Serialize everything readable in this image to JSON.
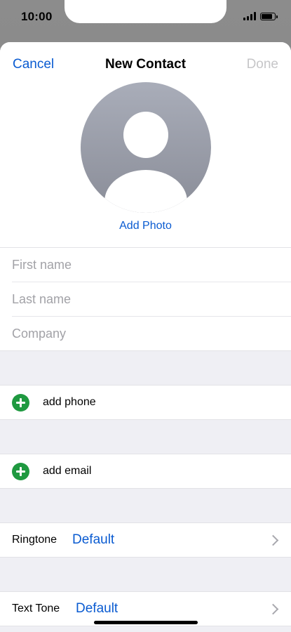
{
  "status_bar": {
    "time": "10:00",
    "signal_bars": 4,
    "battery_level": 0.9
  },
  "nav": {
    "cancel_label": "Cancel",
    "title": "New Contact",
    "done_label": "Done"
  },
  "photo": {
    "add_photo_label": "Add Photo"
  },
  "fields": {
    "first_name_placeholder": "First name",
    "last_name_placeholder": "Last name",
    "company_placeholder": "Company"
  },
  "add_rows": {
    "phone_label": "add phone",
    "email_label": "add email"
  },
  "tones": {
    "ringtone_label": "Ringtone",
    "ringtone_value": "Default",
    "text_tone_label": "Text Tone",
    "text_tone_value": "Default"
  },
  "colors": {
    "accent": "#0a5bd1",
    "add_green": "#1f9940",
    "disabled": "#c6c6c8",
    "placeholder": "#a2a2a7",
    "grouped_background": "#efeff4"
  }
}
